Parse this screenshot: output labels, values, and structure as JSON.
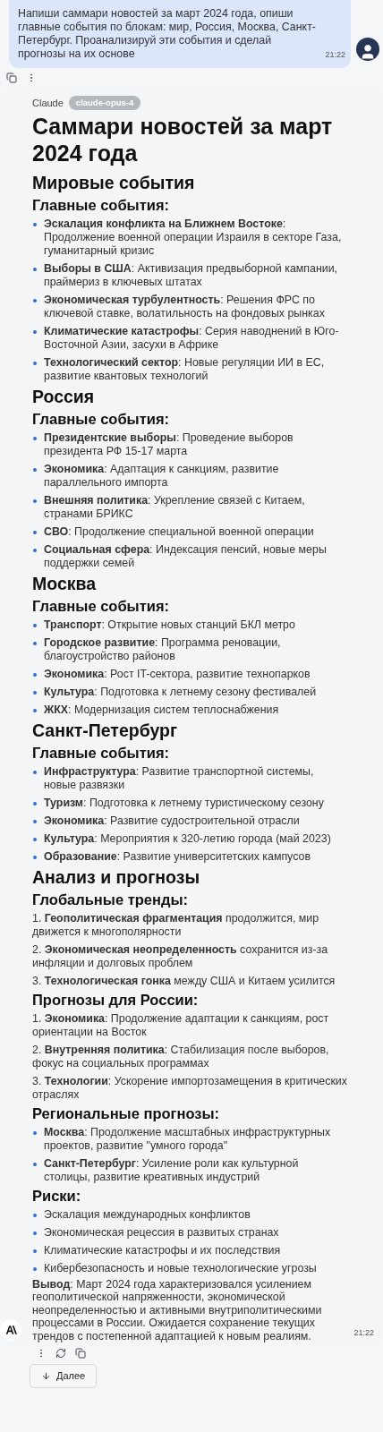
{
  "user_message": {
    "text": "Напиши саммари новостей за март 2024 года, опиши главные события по блокам: мир, Россия, Москва, Санкт-Петербург. Проанализируй эти события и сделай прогнозы на их основе",
    "time": "21:22"
  },
  "assistant": {
    "sender": "Claude",
    "model": "claude-opus-4",
    "time": "21:22",
    "blocks": [
      {
        "kind": "h1",
        "text": "Саммари новостей за март 2024 года"
      },
      {
        "kind": "h2",
        "text": "Мировые события"
      },
      {
        "kind": "h3",
        "text": "Главные события:"
      },
      {
        "kind": "bullets",
        "items": [
          "**Эскалация конфликта на Ближнем Востоке**: Продолжение военной операции Израиля в секторе Газа, гуманитарный кризис",
          "**Выборы в США**: Активизация предвыборной кампании, праймериз в ключевых штатах",
          "**Экономическая турбулентность**: Решения ФРС по ключевой ставке, волатильность на фондовых рынках",
          "**Климатические катастрофы**: Серия наводнений в Юго-Восточной Азии, засухи в Африке",
          "**Технологический сектор**: Новые регуляции ИИ в ЕС, развитие квантовых технологий"
        ]
      },
      {
        "kind": "h2",
        "text": "Россия"
      },
      {
        "kind": "h3",
        "text": "Главные события:"
      },
      {
        "kind": "bullets",
        "items": [
          "**Президентские выборы**: Проведение выборов президента РФ 15-17 марта",
          "**Экономика**: Адаптация к санкциям, развитие параллельного импорта",
          "**Внешняя политика**: Укрепление связей с Китаем, странами БРИКС",
          "**СВО**: Продолжение специальной военной операции",
          "**Социальная сфера**: Индексация пенсий, новые меры поддержки семей"
        ]
      },
      {
        "kind": "h2",
        "text": "Москва"
      },
      {
        "kind": "h3",
        "text": "Главные события:"
      },
      {
        "kind": "bullets",
        "items": [
          "**Транспорт**: Открытие новых станций БКЛ метро",
          "**Городское развитие**: Программа реновации, благоустройство районов",
          "**Экономика**: Рост IT-сектора, развитие технопарков",
          "**Культура**: Подготовка к летнему сезону фестивалей",
          "**ЖКХ**: Модернизация систем теплоснабжения"
        ]
      },
      {
        "kind": "h2",
        "text": "Санкт-Петербург"
      },
      {
        "kind": "h3",
        "text": "Главные события:"
      },
      {
        "kind": "bullets",
        "items": [
          "**Инфраструктура**: Развитие транспортной системы, новые развязки",
          "**Туризм**: Подготовка к летнему туристическому сезону",
          "**Экономика**: Развитие судостроительной отрасли",
          "**Культура**: Мероприятия к 320-летию города (май 2023)",
          "**Образование**: Развитие университетских кампусов"
        ]
      },
      {
        "kind": "h2",
        "text": "Анализ и прогнозы"
      },
      {
        "kind": "h3",
        "text": "Глобальные тренды:"
      },
      {
        "kind": "numbered",
        "items": [
          {
            "number": "1.",
            "text": "**Геополитическая фрагментация** продолжится, мир движется к многополярности"
          },
          {
            "number": "2.",
            "text": "**Экономическая неопределенность** сохранится из-за инфляции и долговых проблем"
          },
          {
            "number": "3.",
            "text": "**Технологическая гонка** между США и Китаем усилится"
          }
        ]
      },
      {
        "kind": "h3",
        "text": "Прогнозы для России:"
      },
      {
        "kind": "numbered",
        "items": [
          {
            "number": "1.",
            "text": "**Экономика**: Продолжение адаптации к санкциям, рост ориентации на Восток"
          },
          {
            "number": "2.",
            "text": "**Внутренняя политика**: Стабилизация после выборов, фокус на социальных программах"
          },
          {
            "number": "3.",
            "text": "**Технологии**: Ускорение импортозамещения в критических отраслях"
          }
        ]
      },
      {
        "kind": "h3",
        "text": "Региональные прогнозы:"
      },
      {
        "kind": "bullets",
        "items": [
          "**Москва**: Продолжение масштабных инфраструктурных проектов, развитие \"умного города\"",
          "**Санкт-Петербург**: Усиление роли как культурной столицы, развитие креативных индустрий"
        ]
      },
      {
        "kind": "h3",
        "text": "Риски:"
      },
      {
        "kind": "bullets",
        "items": [
          "Эскалация международных конфликтов",
          "Экономическая рецессия в развитых странах",
          "Климатические катастрофы и их последствия",
          "Кибербезопасность и новые технологические угрозы"
        ]
      },
      {
        "kind": "paragraph",
        "text": "**Вывод**: Март 2024 года характеризовался усилением геополитической напряженности, экономической неопределенностью и активными внутриполитическими процессами в России. Ожидается сохранение текущих трендов с постепенной адаптацией к новым реалиям."
      }
    ]
  },
  "next_button": {
    "label": "Далее"
  }
}
